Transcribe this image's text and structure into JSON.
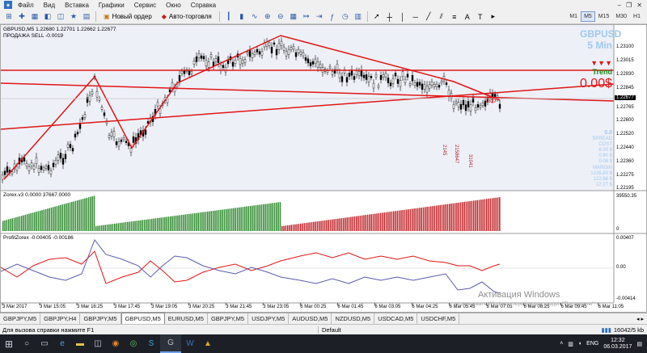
{
  "menu": {
    "items": [
      "Файл",
      "Вид",
      "Вставка",
      "Графики",
      "Сервис",
      "Окно",
      "Справка"
    ]
  },
  "toolbar": {
    "new_order": "Новый ордер",
    "auto_trading": "Авто-торговля",
    "timeframes": [
      "M1",
      "M5",
      "M15",
      "M30",
      "H1"
    ],
    "active_timeframe": "M5"
  },
  "chart": {
    "header": "GBPUSD,M5  1.22680 1.22701 1.22662 1.22677",
    "trade_line": "ПРОДАЖА SELL -0.0019",
    "panel": {
      "symbol": "GBPUSD",
      "timeframe": "5 Min",
      "arrows": "▼▼▼",
      "trend_label": "Trend",
      "profit": "0.00$",
      "spread_value": "0.8",
      "spread_label": "SPREAD",
      "cost_label": "COST",
      "cost_values": [
        "8.00 $",
        "0.80 $",
        "0.08 $"
      ],
      "margin_label": "MARGIN",
      "margin_values": [
        "1226.85 $",
        "122.68 $",
        "12.27 $"
      ]
    },
    "timer": "2:37",
    "vertical_texts": [
      "2145",
      "2158647",
      "31041"
    ],
    "price_labels": [
      "1.23100",
      "1.23015",
      "1.22930",
      "1.22845",
      "1.22765",
      "1.22600",
      "1.22520",
      "1.22440",
      "1.22360",
      "1.22275",
      "1.22195"
    ],
    "current_price": "1.22677",
    "time_labels": [
      "3 Mar 2017",
      "3 Mar 15:05",
      "3 Mar 16:25",
      "3 Mar 17:45",
      "3 Mar 19:05",
      "3 Mar 20:25",
      "3 Mar 21:45",
      "3 Mar 23:05",
      "6 Mar 00:25",
      "6 Mar 01:45",
      "6 Mar 03:05",
      "6 Mar 04:25",
      "6 Mar 05:45",
      "6 Mar 07:05",
      "6 Mar 08:25",
      "6 Mar 09:45",
      "6 Mar 11:05"
    ]
  },
  "indicator1": {
    "label": "Zorex.v3 0.0000 37667.0000",
    "scale_top": "39550.35",
    "scale_bottom": "0",
    "color_up": "#2f8a2f",
    "color_down": "#c0262b"
  },
  "indicator2": {
    "label": "ProfitZorex -0.00405 -0.00186",
    "scale": [
      "0.00407",
      "0.00",
      "-0.00414"
    ]
  },
  "watermark": {
    "title": "Активация Windows",
    "subtitle": "активировать Windows, перейдите в раздел \"Параметры\"."
  },
  "tabs": [
    "GBPJPY,M5",
    "GBPJPY,H4",
    "GBPJPY,M5",
    "GBPUSD,M5",
    "EURUSD,M5",
    "GBPJPY,M5",
    "USDJPY,M5",
    "AUDUSD,M5",
    "NZDUSD,M5",
    "USDCAD,M5",
    "USDCHF,M5"
  ],
  "active_tab": 3,
  "status": {
    "help": "Для вызова справки нажмите F1",
    "profile": "Default",
    "traffic": "16042/5 kb"
  },
  "taskbar": {
    "lang": "ENG",
    "time": "12:32",
    "date": "06.03.2017"
  },
  "colors": {
    "accent": "#c0262b",
    "panel_blue": "#9fc8ef",
    "trend_green": "#1a8a1a"
  }
}
